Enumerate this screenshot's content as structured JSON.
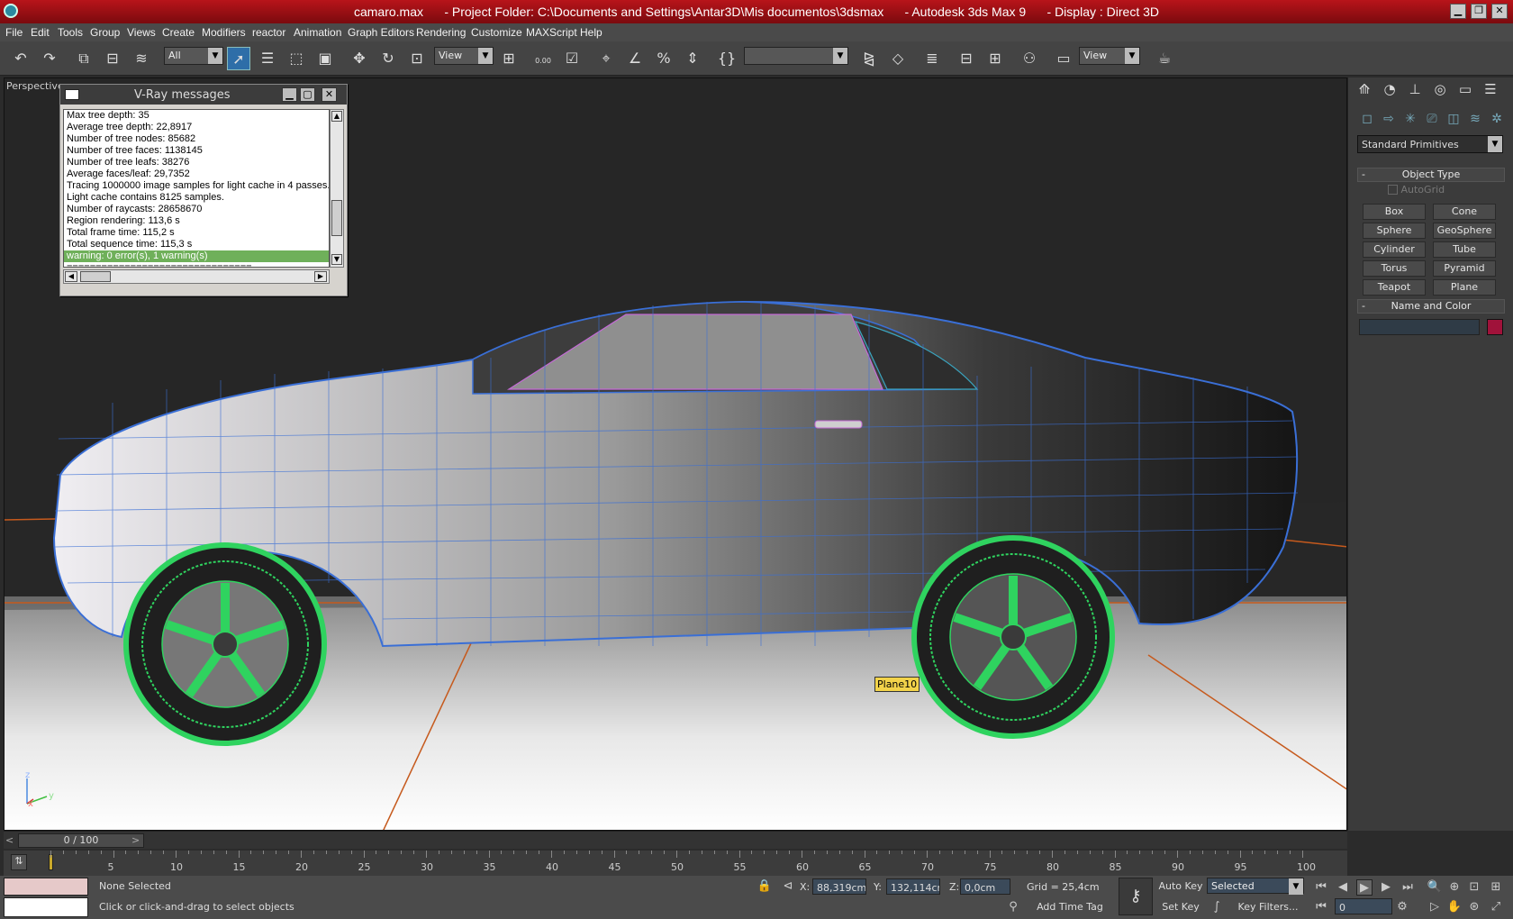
{
  "window": {
    "title": "camaro.max      - Project Folder: C:\\Documents and Settings\\Antar3D\\Mis documentos\\3dsmax      - Autodesk 3ds Max 9      - Display : Direct 3D",
    "minimize_icon": "minimize-icon",
    "restore_icon": "restore-icon",
    "close_icon": "close-icon"
  },
  "menu": [
    "File",
    "Edit",
    "Tools",
    "Group",
    "Views",
    "Create",
    "Modifiers",
    "reactor",
    "Animation",
    "Graph Editors",
    "Rendering",
    "Customize",
    "MAXScript",
    "Help"
  ],
  "toolbar": {
    "selection_filter": "All",
    "reference_coord": "View",
    "snap_value": "0.00",
    "named_selection": "",
    "view_dropdown": "View"
  },
  "viewport": {
    "label": "Perspective",
    "object_tag": "Plane10",
    "background": "#262626",
    "car_wire_color": "#3a6fd6",
    "wheel_wire_color": "#2fd35f",
    "ground_line_color": "#c65a1d"
  },
  "vray": {
    "title": "V-Ray messages",
    "lines": [
      "Max tree depth: 35",
      "Average tree depth: 22,8917",
      "Number of tree nodes: 85682",
      "Number of tree faces: 1138145",
      "Number of tree leafs: 38276",
      "Average faces/leaf: 29,7352",
      "Tracing 1000000 image samples for light cache in 4 passes.",
      "Light cache contains 8125 samples.",
      "Number of raycasts: 28658670",
      "Region rendering: 113,6 s",
      "Total frame time: 115,2 s",
      "Total sequence time: 115,3 s"
    ],
    "warning_line": "warning: 0 error(s), 1 warning(s)",
    "separator": "================================"
  },
  "command_panel": {
    "category": "Standard Primitives",
    "object_type_title": "Object Type",
    "autogrid_label": "AutoGrid",
    "primitives": [
      "Box",
      "Cone",
      "Sphere",
      "GeoSphere",
      "Cylinder",
      "Tube",
      "Torus",
      "Pyramid",
      "Teapot",
      "Plane"
    ],
    "name_color_title": "Name and Color",
    "name_value": "",
    "object_color": "#a0123a",
    "rollout_collapse": "-"
  },
  "timeline": {
    "slider_text": "0 / 100",
    "ticks": [
      "5",
      "10",
      "15",
      "20",
      "25",
      "30",
      "35",
      "40",
      "45",
      "50",
      "55",
      "60",
      "65",
      "70",
      "75",
      "80",
      "85",
      "90",
      "95",
      "100"
    ]
  },
  "status": {
    "selection": "None Selected",
    "prompt": "Click or click-and-drag to select objects",
    "x_label": "X:",
    "x_value": "88,319cm",
    "y_label": "Y:",
    "y_value": "132,114cm",
    "z_label": "Z:",
    "z_value": "0,0cm",
    "grid": "Grid = 25,4cm",
    "add_time_tag": "Add Time Tag",
    "auto_key": "Auto Key",
    "set_key": "Set Key",
    "key_mode": "Selected",
    "key_filters": "Key Filters...",
    "frame": "0"
  }
}
